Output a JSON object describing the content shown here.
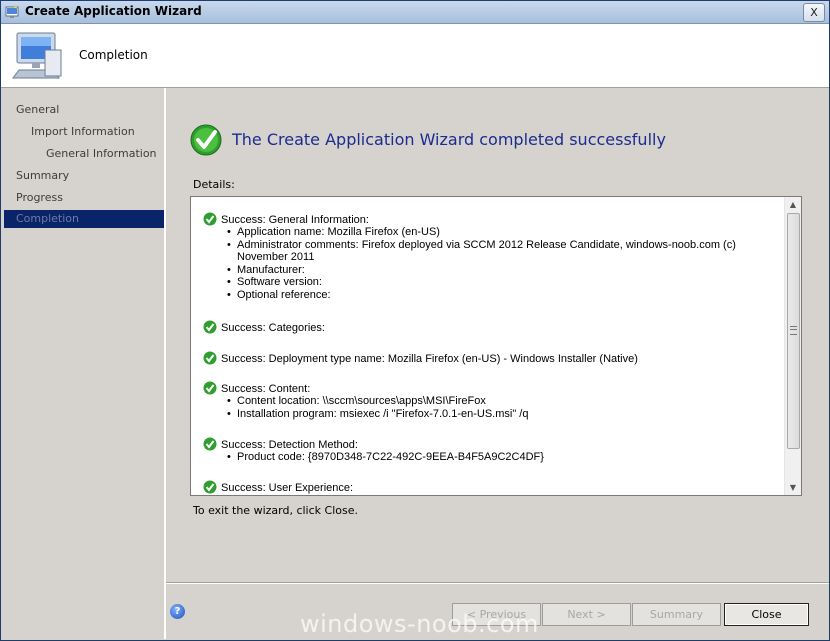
{
  "window": {
    "title": "Create Application Wizard",
    "close_glyph": "X"
  },
  "header": {
    "title": "Completion",
    "icon": "computer-monitor-icon"
  },
  "nav": {
    "items": [
      {
        "label": "General",
        "active": false
      },
      {
        "label": "Import Information",
        "active": false
      },
      {
        "label": "General Information",
        "active": false
      },
      {
        "label": "Summary",
        "active": false
      },
      {
        "label": "Progress",
        "active": false
      },
      {
        "label": "Completion",
        "active": true
      }
    ]
  },
  "main": {
    "heading": "The Create Application Wizard completed successfully",
    "details_label": "Details:",
    "sections": [
      {
        "title": "Success: General Information:",
        "bullets": [
          "Application name: Mozilla Firefox (en-US)",
          "Administrator comments: Firefox deployed via SCCM 2012 Release Candidate, windows-noob.com (c) November 2011",
          "Manufacturer:",
          "Software version:",
          "Optional reference:"
        ]
      },
      {
        "title": "Success: Categories:",
        "bullets": []
      },
      {
        "title": "Success: Deployment type name: Mozilla Firefox (en-US) - Windows Installer (Native)",
        "bullets": []
      },
      {
        "title": "Success: Content:",
        "bullets": [
          "Content location: \\\\sccm\\sources\\apps\\MSI\\FireFox",
          "Installation program: msiexec /i \"Firefox-7.0.1-en-US.msi\" /q"
        ]
      },
      {
        "title": "Success: Detection Method:",
        "bullets": [
          "Product code: {8970D348-7C22-492C-9EEA-B4F5A9C2C4DF}"
        ]
      },
      {
        "title": "Success: User Experience:",
        "bullets": []
      }
    ],
    "exit_text": "To exit the wizard, click Close."
  },
  "footer": {
    "help_glyph": "?",
    "buttons": {
      "previous": "< Previous",
      "next": "Next >",
      "summary": "Summary",
      "close": "Close"
    }
  },
  "watermark": "windows-noob.com",
  "colors": {
    "accent_heading": "#1c2b8f",
    "nav_active_bg": "#0a246a",
    "success_green": "#2e9e2e"
  }
}
